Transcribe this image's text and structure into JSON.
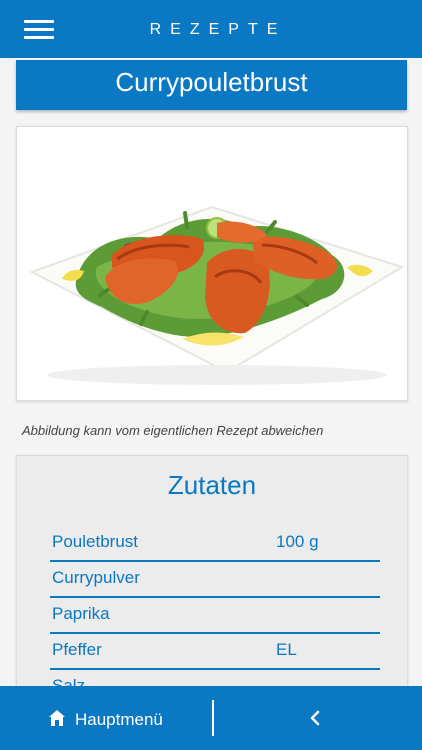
{
  "header": {
    "title": "REZEPTE",
    "menu_icon": "hamburger-menu-icon"
  },
  "recipe": {
    "title": "Currypouletbrust",
    "image": "recipe-photo",
    "disclaimer": "Abbildung kann vom eigentlichen Rezept abweichen"
  },
  "ingredients": {
    "title": "Zutaten",
    "rows": [
      {
        "name": "Pouletbrust",
        "qty": "100 g"
      },
      {
        "name": "Currypulver",
        "qty": ""
      },
      {
        "name": "Paprika",
        "qty": ""
      },
      {
        "name": "Pfeffer",
        "qty": "EL"
      },
      {
        "name": "Salz",
        "qty": ""
      }
    ]
  },
  "footer": {
    "home_label": "Hauptmenü",
    "home_icon": "home-icon",
    "back_icon": "chevron-left-icon"
  },
  "colors": {
    "primary": "#0a78c2",
    "background": "#f4f4f4",
    "card": "#ececec"
  }
}
